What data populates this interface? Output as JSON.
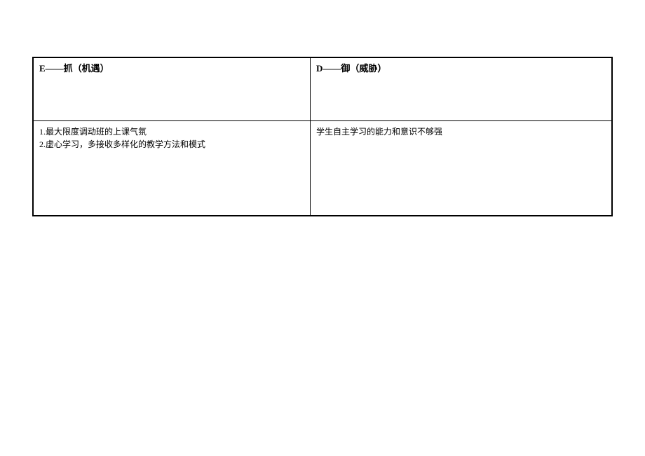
{
  "table": {
    "header": {
      "left": "E——抓（机遇）",
      "right": "D——御（威胁）"
    },
    "content": {
      "left": "1.最大限度调动班的上课气氛\n2.虚心学习，多接收多样化的教学方法和模式",
      "right": "学生自主学习的能力和意识不够强"
    }
  }
}
